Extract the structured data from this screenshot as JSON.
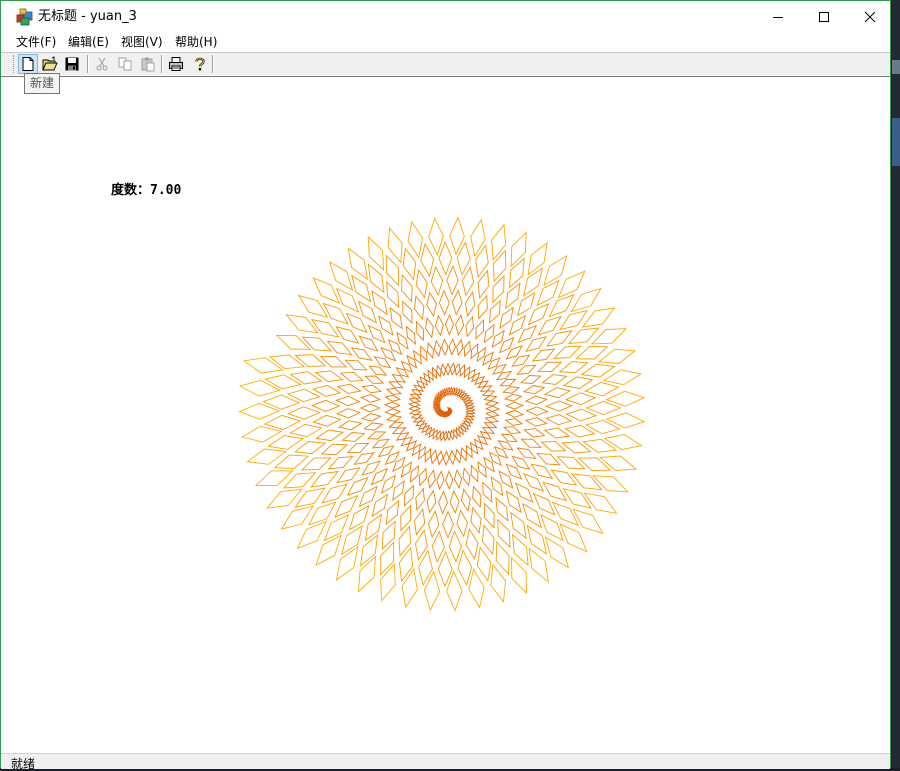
{
  "window": {
    "title": "无标题 - yuan_3",
    "controls": {
      "minimize": "minimize-icon",
      "maximize": "maximize-icon",
      "close": "close-icon"
    }
  },
  "menu": {
    "items": [
      {
        "label": "文件(F)"
      },
      {
        "label": "编辑(E)"
      },
      {
        "label": "视图(V)"
      },
      {
        "label": "帮助(H)"
      }
    ]
  },
  "toolbar": {
    "buttons": [
      {
        "icon": "new-file-icon",
        "enabled": true
      },
      {
        "icon": "open-folder-icon",
        "enabled": true
      },
      {
        "icon": "save-icon",
        "enabled": true
      },
      {
        "icon": "cut-icon",
        "enabled": false
      },
      {
        "icon": "copy-icon",
        "enabled": false
      },
      {
        "icon": "paste-icon",
        "enabled": false
      },
      {
        "icon": "print-icon",
        "enabled": true
      },
      {
        "icon": "help-icon",
        "enabled": true
      }
    ],
    "tooltip": "新建"
  },
  "canvas": {
    "degree_label": "度数：7.00",
    "spiral": {
      "shape": "diamond",
      "color_inner": "#e05a00",
      "color_outer": "#ffb000"
    }
  },
  "status": {
    "text": "就绪"
  }
}
